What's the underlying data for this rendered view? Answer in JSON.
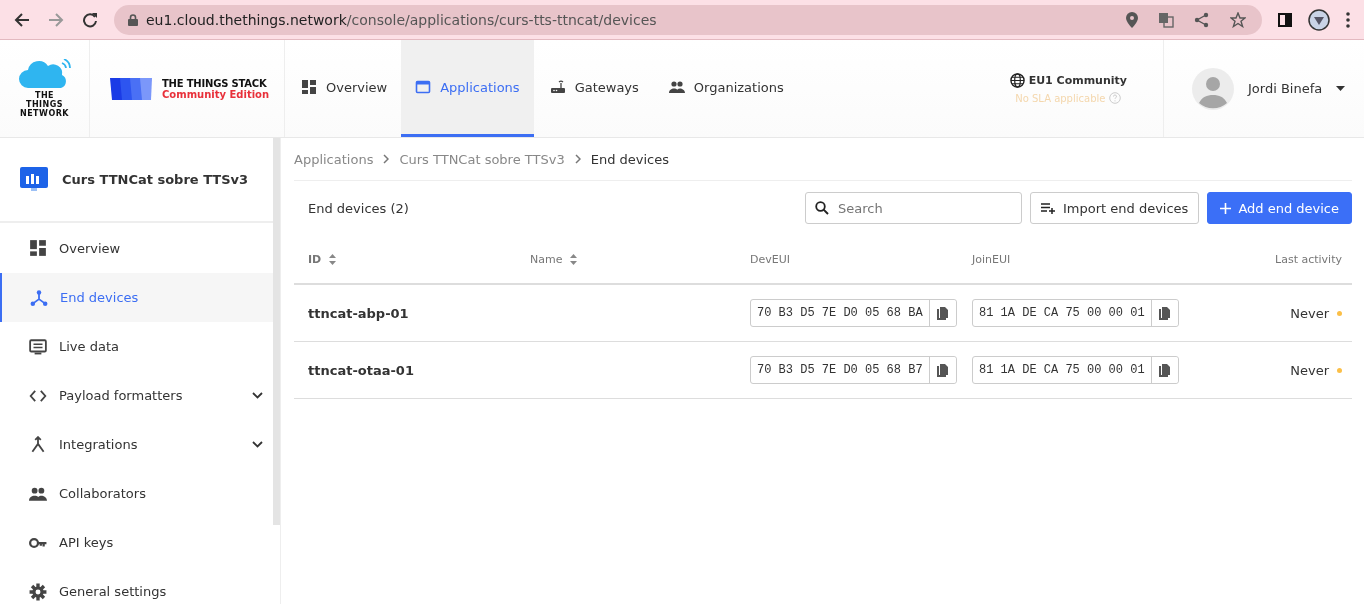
{
  "browser": {
    "url_host": "eu1.cloud.thethings.network",
    "url_path": "/console/applications/curs-tts-ttncat/devices"
  },
  "header": {
    "ttn_logo": "THE THINGS NETWORK",
    "stack_title": "THE THINGS STACK",
    "stack_edition": "Community Edition",
    "nav": [
      {
        "label": "Overview",
        "selected": false
      },
      {
        "label": "Applications",
        "selected": true
      },
      {
        "label": "Gateways",
        "selected": false
      },
      {
        "label": "Organizations",
        "selected": false
      }
    ],
    "cluster": {
      "name": "EU1 Community",
      "sla": "No SLA applicable"
    },
    "user": {
      "name": "Jordi Binefa"
    }
  },
  "sidebar": {
    "app_title": "Curs TTNCat sobre TTSv3",
    "items": [
      {
        "label": "Overview",
        "selected": false,
        "expandable": false
      },
      {
        "label": "End devices",
        "selected": true,
        "expandable": false
      },
      {
        "label": "Live data",
        "selected": false,
        "expandable": false
      },
      {
        "label": "Payload formatters",
        "selected": false,
        "expandable": true
      },
      {
        "label": "Integrations",
        "selected": false,
        "expandable": true
      },
      {
        "label": "Collaborators",
        "selected": false,
        "expandable": false
      },
      {
        "label": "API keys",
        "selected": false,
        "expandable": false
      },
      {
        "label": "General settings",
        "selected": false,
        "expandable": false
      }
    ]
  },
  "breadcrumbs": [
    "Applications",
    "Curs TTNCat sobre TTSv3",
    "End devices"
  ],
  "table": {
    "title": "End devices (2)",
    "search": {
      "placeholder": "Search"
    },
    "import_button": "Import end devices",
    "add_button": "Add end device",
    "columns": [
      {
        "label": "ID",
        "sortable": true
      },
      {
        "label": "Name",
        "sortable": true
      },
      {
        "label": "DevEUI",
        "sortable": false
      },
      {
        "label": "JoinEUI",
        "sortable": false
      },
      {
        "label": "Last activity",
        "sortable": false
      }
    ],
    "rows": [
      {
        "id": "ttncat-abp-01",
        "dev_eui": "70 B3 D5 7E D0 05 68 BA",
        "join_eui": "81 1A DE CA 75 00 00 01",
        "last_activity": "Never",
        "color": "#fbbf47"
      },
      {
        "id": "ttncat-otaa-01",
        "dev_eui": "70 B3 D5 7E D0 05 68 B7",
        "join_eui": "81 1A DE CA 75 00 00 01",
        "last_activity": "Never",
        "color": "#fbbf47"
      }
    ]
  }
}
